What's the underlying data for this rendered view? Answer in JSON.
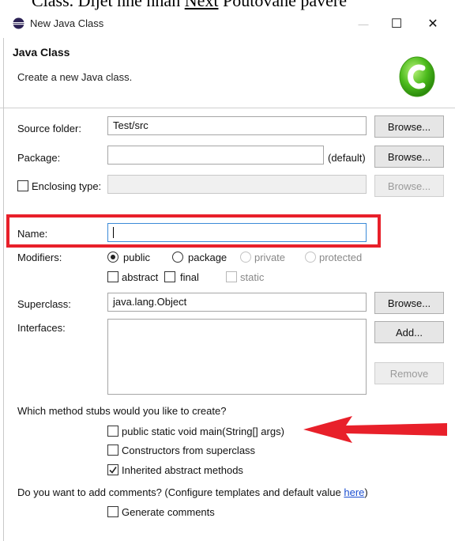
{
  "doc_snippet": {
    "before": "Class. Dijet nhe nhan ",
    "underlined": "Next",
    "after": " Poutovane pavere"
  },
  "window": {
    "title": "New Java Class",
    "minimize": "—",
    "maximize": "☐",
    "close": "✕"
  },
  "header": {
    "title": "Java Class",
    "description": "Create a new Java class."
  },
  "form": {
    "source_folder": {
      "label": "Source folder:",
      "value": "Test/src",
      "button": "Browse..."
    },
    "package": {
      "label": "Package:",
      "value": "",
      "suffix": "(default)",
      "button": "Browse..."
    },
    "enclosing_type": {
      "label": "Enclosing type:",
      "value": "",
      "button": "Browse...",
      "checked": false
    },
    "name": {
      "label": "Name:",
      "value": ""
    },
    "modifiers": {
      "label": "Modifiers:",
      "public": "public",
      "package": "package",
      "private": "private",
      "protected": "protected",
      "abstract": "abstract",
      "final": "final",
      "static": "static",
      "selected": "public"
    },
    "superclass": {
      "label": "Superclass:",
      "value": "java.lang.Object",
      "button": "Browse..."
    },
    "interfaces": {
      "label": "Interfaces:",
      "add_button": "Add...",
      "remove_button": "Remove"
    }
  },
  "stubs": {
    "question": "Which method stubs would you like to create?",
    "main": {
      "label": "public static void main(String[] args)",
      "checked": false
    },
    "constructors": {
      "label": "Constructors from superclass",
      "checked": false
    },
    "inherited": {
      "label": "Inherited abstract methods",
      "checked": true
    }
  },
  "comments": {
    "question_prefix": "Do you want to add comments? (Configure templates and default value ",
    "link": "here",
    "question_suffix": ")",
    "generate": {
      "label": "Generate comments",
      "checked": false
    }
  },
  "colors": {
    "highlight": "#e8202a",
    "link": "#1c4fd1",
    "focus": "#3b8ad8"
  }
}
